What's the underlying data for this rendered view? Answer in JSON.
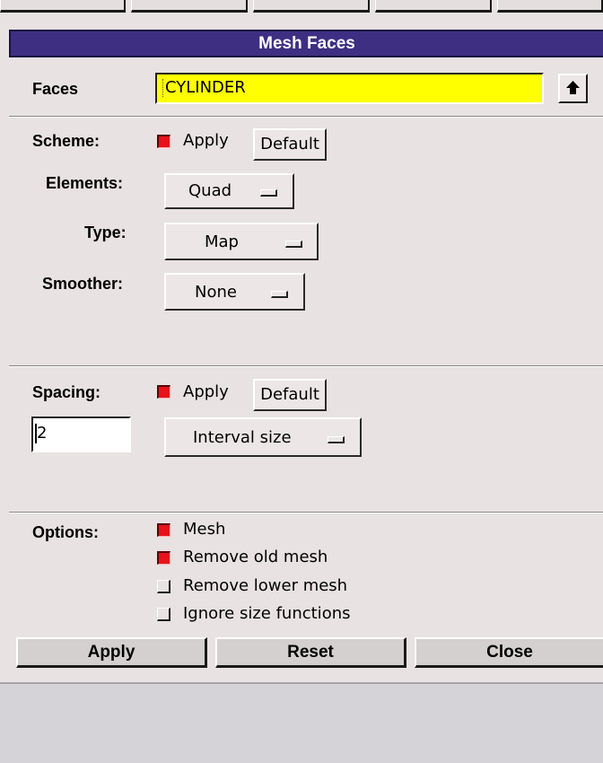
{
  "window": {
    "title": "Mesh Faces"
  },
  "faces": {
    "label": "Faces",
    "value": "CYLINDER",
    "select_icon": "up-arrow-icon"
  },
  "scheme": {
    "label": "Scheme:",
    "apply_label": "Apply",
    "apply_checked": true,
    "default_label": "Default",
    "elements_label": "Elements:",
    "elements_value": "Quad",
    "type_label": "Type:",
    "type_value": "Map",
    "smoother_label": "Smoother:",
    "smoother_value": "None"
  },
  "spacing": {
    "label": "Spacing:",
    "apply_label": "Apply",
    "apply_checked": true,
    "default_label": "Default",
    "value": "2",
    "method_value": "Interval size"
  },
  "options": {
    "label": "Options:",
    "items": [
      {
        "label": "Mesh",
        "checked": true
      },
      {
        "label": "Remove old mesh",
        "checked": true
      },
      {
        "label": "Remove lower mesh",
        "checked": false
      },
      {
        "label": "Ignore size functions",
        "checked": false
      }
    ]
  },
  "actions": {
    "apply": "Apply",
    "reset": "Reset",
    "close": "Close"
  },
  "colors": {
    "title_bar": "#3e2f83",
    "faces_field": "#ffff00",
    "checkbox_on": "#e8121a",
    "panel_bg": "#e8e2e2"
  }
}
